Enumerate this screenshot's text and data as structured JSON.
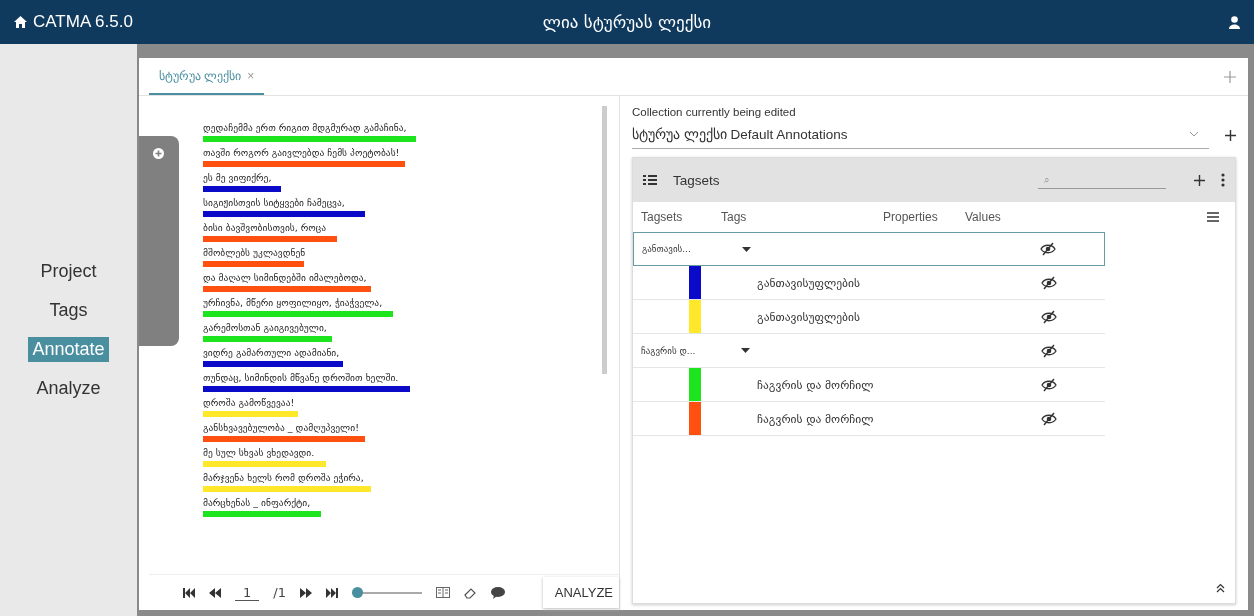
{
  "header": {
    "app_title": "CATMA 6.5.0",
    "document_title": "ლია სტურუას ლექსი"
  },
  "nav": [
    {
      "label": "Project",
      "selected": false
    },
    {
      "label": "Tags",
      "selected": false
    },
    {
      "label": "Annotate",
      "selected": true
    },
    {
      "label": "Analyze",
      "selected": false
    }
  ],
  "tabs": [
    {
      "label": "სტურუა ლექსი",
      "close": "×",
      "selected": true
    }
  ],
  "text_lines": [
    {
      "text": "დედაჩემმა ერთ რიგით მდგმურად გამაჩინა,",
      "color": "#1de51d"
    },
    {
      "text": "თავში როგორ გაივლებდა ჩემს პოეტობას!",
      "color": "#ff5010"
    },
    {
      "text": "ეს მე ვიფიქრე,",
      "color": "#0a0ac8"
    },
    {
      "text": "სიგიჟისთვის სიტყვები ჩამეცვა,",
      "color": "#0a0ac8"
    },
    {
      "text": "ბისი ბავშვობისთვის, როცა",
      "color": "#ff5010"
    },
    {
      "text": "მშობლებს უკლავდნენ",
      "color": "#ff5010"
    },
    {
      "text": "და მაღალ სიმინდებში იმალებოდა,",
      "color": "#ff5010"
    },
    {
      "text": "ურჩივნა, მწერი ყოფილიყო, ჭიაჭველა,",
      "color": "#1de51d"
    },
    {
      "text": "გარემოსთან გაიგივებული,",
      "color": "#1de51d"
    },
    {
      "text": "ვიდრე გამართული ადამიანი,",
      "color": "#0a0ac8"
    },
    {
      "text": "თუნდაც, სიმინდის მწვანე დროშით ხელში.",
      "color": "#0a0ac8"
    },
    {
      "text": "დროშა გამოწვევაა!",
      "color": "#ffe82a"
    },
    {
      "text": "განსხვავებულობა _ დამღუპველი!",
      "color": "#ff5010"
    },
    {
      "text": "მე სულ სხვას ვხედავდი.",
      "color": "#ffe82a"
    },
    {
      "text": "მარჯვენა ხელს რომ დროშა ეჭირა,",
      "color": "#ffe82a"
    },
    {
      "text": "მარცხენას _ ინფარქტი,",
      "color": "#1de51d"
    }
  ],
  "pager": {
    "page": "1",
    "total": "/1",
    "button": "ANALYZE",
    "zoom": {
      "level": 0
    }
  },
  "collection": {
    "label": "Collection currently being edited",
    "value": "სტურუა ლექსი Default Annotations"
  },
  "tagsets_panel": {
    "title": "Tagsets",
    "search_placeholder": "⌕",
    "columns": [
      "Tagsets",
      "Tags",
      "Properties",
      "Values"
    ],
    "rows": [
      {
        "kind": "tagset",
        "name": "განთავის...",
        "selected": true
      },
      {
        "kind": "tag",
        "name": "განთავისუფლების",
        "color": "#0a0ac8",
        "selected": false
      },
      {
        "kind": "tag",
        "name": "განთავისუფლების",
        "color": "#ffe82a",
        "selected": false
      },
      {
        "kind": "tagset",
        "name": "ჩაგვრის დ...",
        "selected": false
      },
      {
        "kind": "tag",
        "name": "ჩაგვრის და მორჩილ",
        "color": "#1de51d",
        "selected": false
      },
      {
        "kind": "tag",
        "name": "ჩაგვრის და მორჩილ",
        "color": "#ff5010",
        "selected": false
      }
    ]
  }
}
